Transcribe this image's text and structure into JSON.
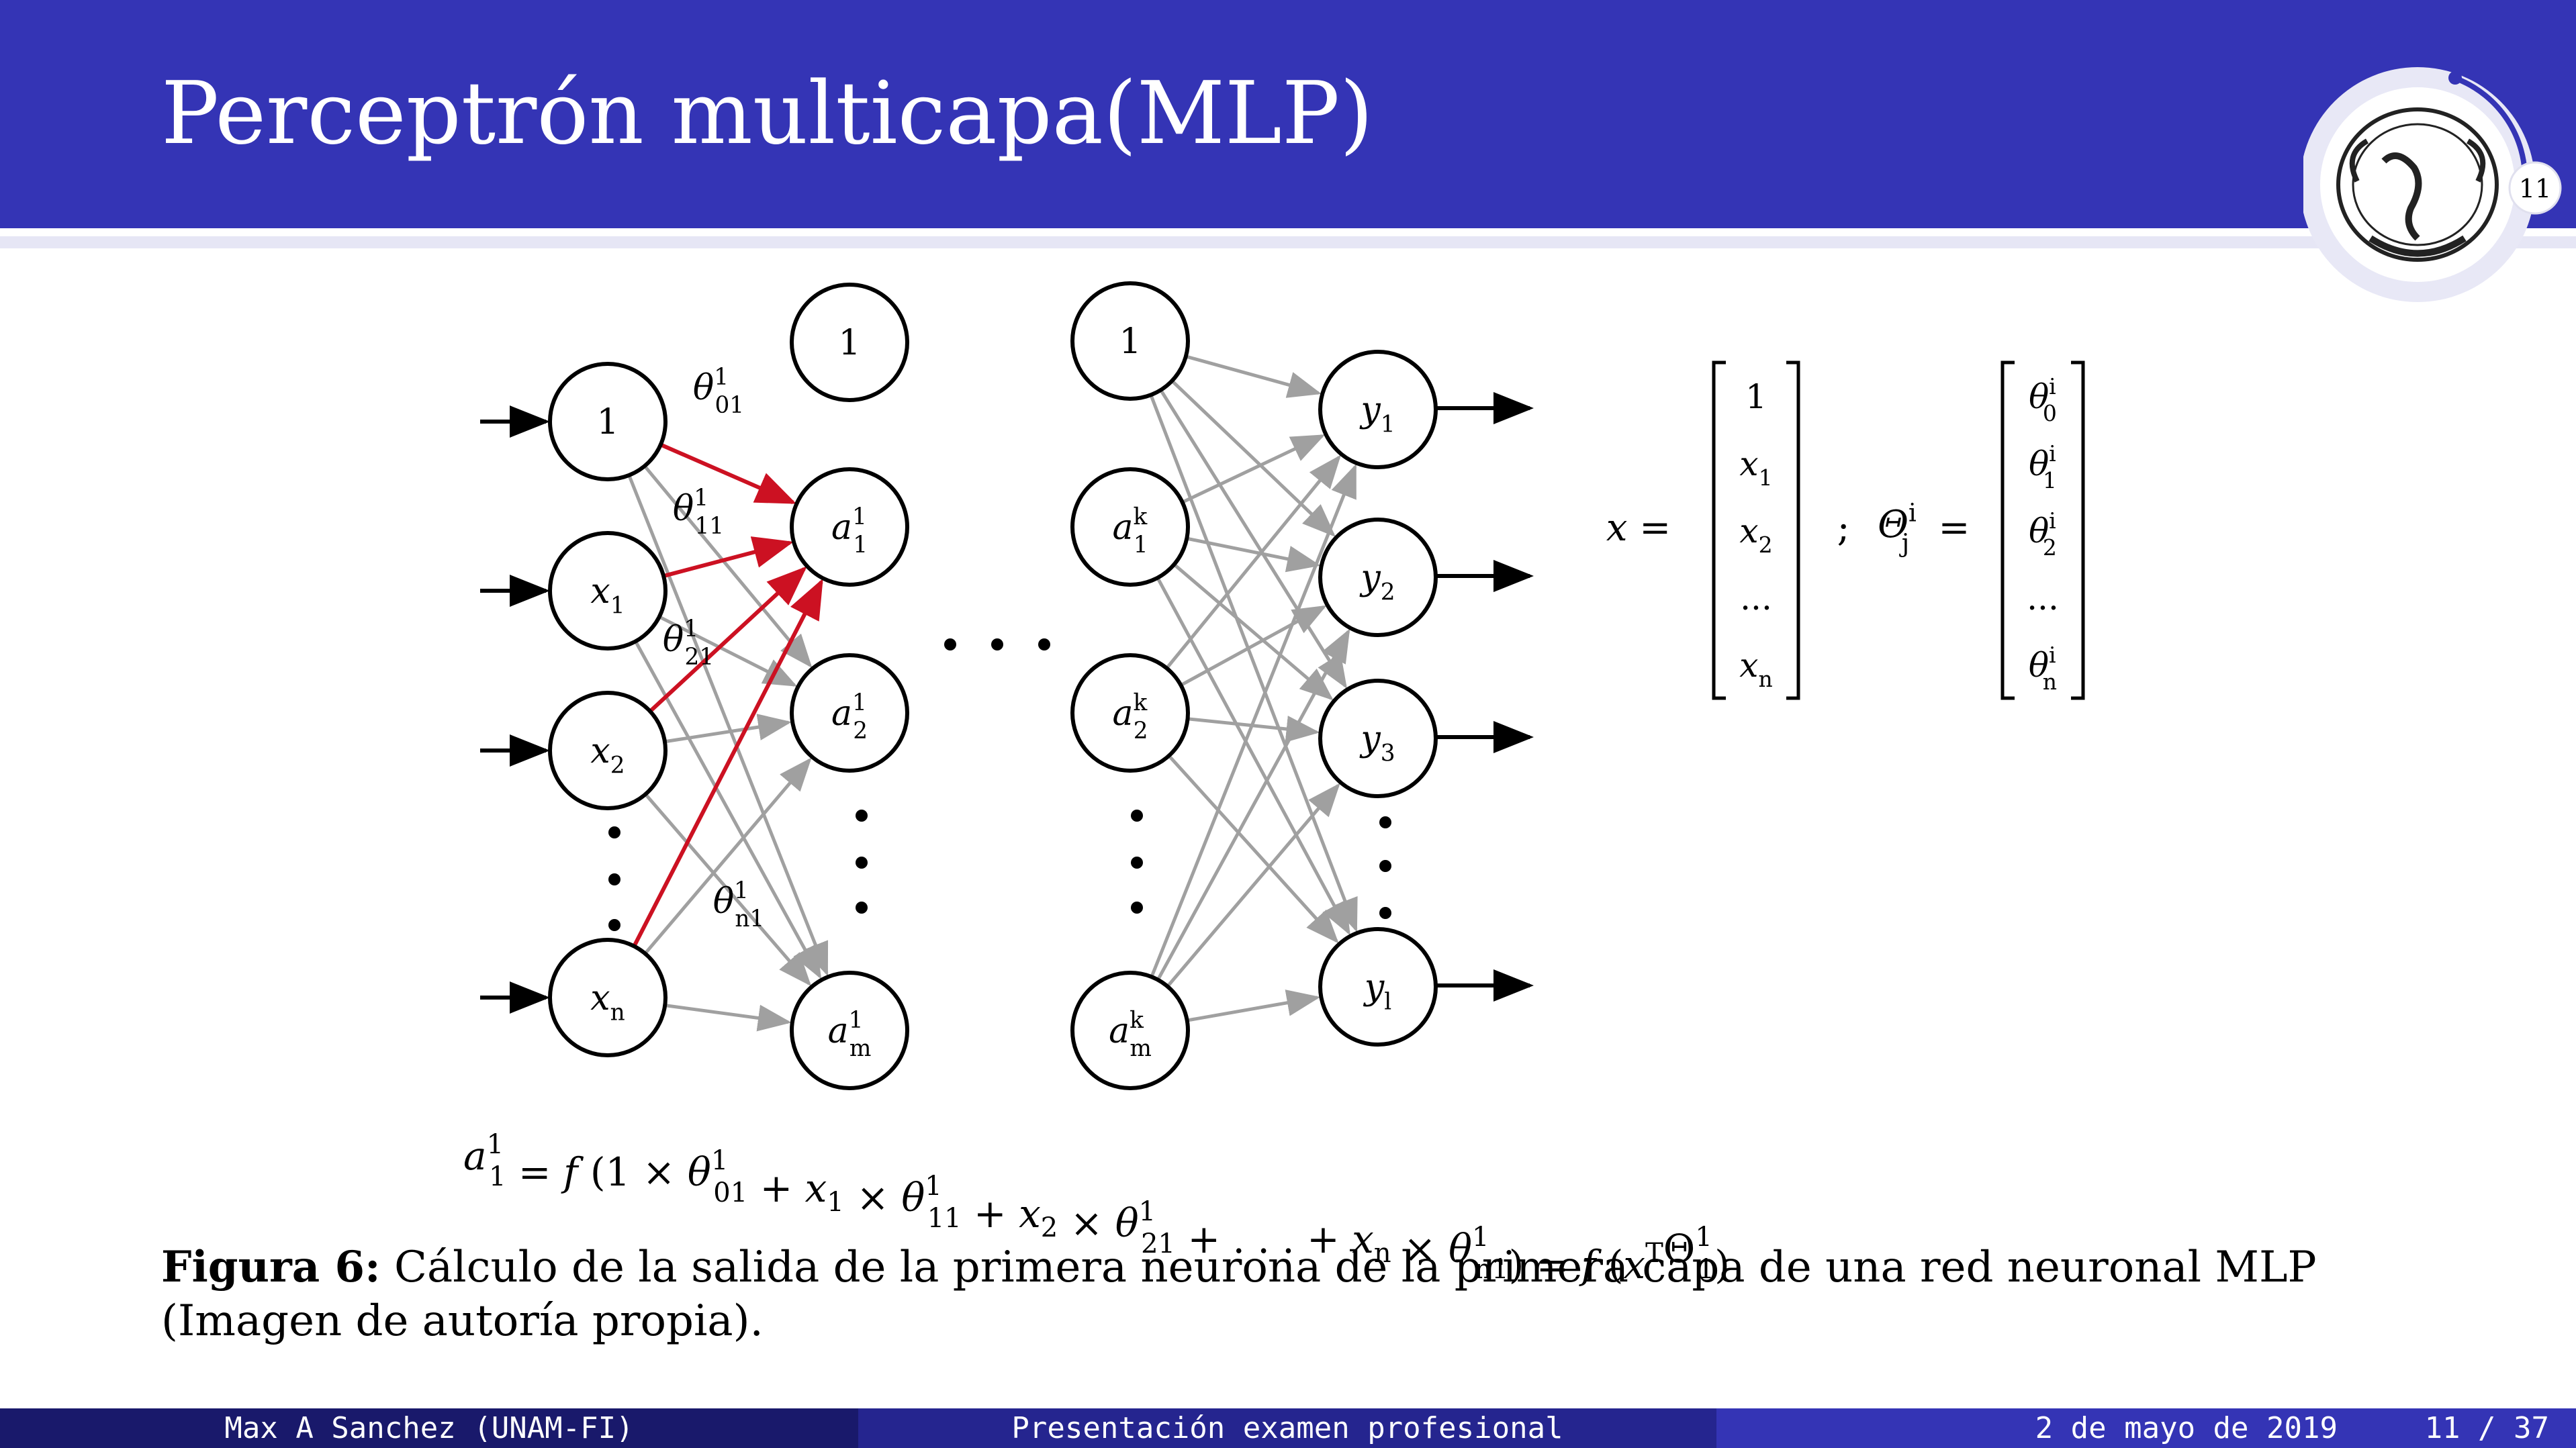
{
  "slide": {
    "title": "Perceptrón multicapa(MLP)",
    "slide_number": "11"
  },
  "diagram": {
    "input_layer": {
      "bias": "1",
      "nodes": [
        {
          "base": "x",
          "sub": "1"
        },
        {
          "base": "x",
          "sub": "2"
        },
        {
          "base": "x",
          "sub": "n"
        }
      ]
    },
    "hidden_layer_1": {
      "bias": "1",
      "nodes": [
        {
          "base": "a",
          "sub": "1",
          "sup": "1"
        },
        {
          "base": "a",
          "sub": "2",
          "sup": "1"
        },
        {
          "base": "a",
          "sub": "m",
          "sup": "1"
        }
      ]
    },
    "hidden_layer_k": {
      "bias": "1",
      "nodes": [
        {
          "base": "a",
          "sub": "1",
          "sup": "k"
        },
        {
          "base": "a",
          "sub": "2",
          "sup": "k"
        },
        {
          "base": "a",
          "sub": "m",
          "sup": "k"
        }
      ]
    },
    "output_layer": {
      "nodes": [
        {
          "base": "y",
          "sub": "1"
        },
        {
          "base": "y",
          "sub": "2"
        },
        {
          "base": "y",
          "sub": "3"
        },
        {
          "base": "y",
          "sub": "l"
        }
      ]
    },
    "weight_labels": [
      {
        "base": "θ",
        "sup": "1",
        "sub": "01"
      },
      {
        "base": "θ",
        "sup": "1",
        "sub": "11"
      },
      {
        "base": "θ",
        "sup": "1",
        "sub": "21"
      },
      {
        "base": "θ",
        "sup": "1",
        "sub": "n1"
      }
    ],
    "highlight_color": "#cc1122",
    "edge_color": "#a0a0a0"
  },
  "vectors": {
    "x_label": "x =",
    "separator": ";",
    "theta_label": "Θ",
    "theta_sub": "j",
    "theta_sup": "i",
    "equals": "=",
    "x_entries": [
      {
        "base": "1",
        "sub": ""
      },
      {
        "base": "x",
        "sub": "1"
      },
      {
        "base": "x",
        "sub": "2"
      },
      {
        "base": "...",
        "sub": ""
      },
      {
        "base": "x",
        "sub": "n"
      }
    ],
    "theta_entries": [
      {
        "base": "θ",
        "sub": "0",
        "sup": "i"
      },
      {
        "base": "θ",
        "sub": "1",
        "sup": "i"
      },
      {
        "base": "θ",
        "sub": "2",
        "sup": "i"
      },
      {
        "base": "...",
        "sub": "",
        "sup": ""
      },
      {
        "base": "θ",
        "sub": "n",
        "sup": "i"
      }
    ]
  },
  "caption": {
    "label": "Figura 6:",
    "text": "Cálculo de la salida de la primera neurona de la primera capa de una red neuronal MLP (Imagen de autoría propia)."
  },
  "footer": {
    "author": "Max A Sanchez  (UNAM-FI)",
    "presentation": "Presentación examen profesional",
    "date": "2 de mayo de 2019",
    "page": "11 / 37"
  }
}
